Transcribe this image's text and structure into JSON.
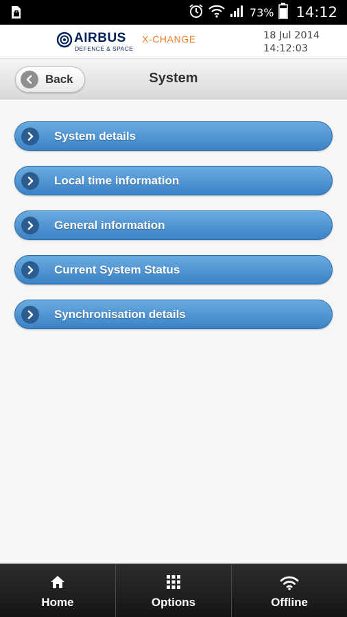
{
  "status_bar": {
    "battery_percent": "73%",
    "time": "14:12",
    "icons": [
      "sd-card-icon",
      "alarm-icon",
      "wifi-icon",
      "signal-icon",
      "battery-icon"
    ]
  },
  "header": {
    "brand_name": "AIRBUS",
    "brand_sub": "DEFENCE & SPACE",
    "product": "X-CHANGE",
    "date": "18 Jul 2014",
    "time": "14:12:03",
    "colors": {
      "brand": "#00205b",
      "product": "#f07a1e"
    }
  },
  "titlebar": {
    "back_label": "Back",
    "title": "System"
  },
  "menu": {
    "items": [
      {
        "label": "System details"
      },
      {
        "label": "Local time information"
      },
      {
        "label": "General information"
      },
      {
        "label": "Current System Status"
      },
      {
        "label": "Synchronisation details"
      }
    ],
    "color": "#3f88c9"
  },
  "bottom_nav": {
    "items": [
      {
        "label": "Home",
        "icon": "home-icon"
      },
      {
        "label": "Options",
        "icon": "grid-icon"
      },
      {
        "label": "Offline",
        "icon": "wifi-icon"
      }
    ]
  }
}
